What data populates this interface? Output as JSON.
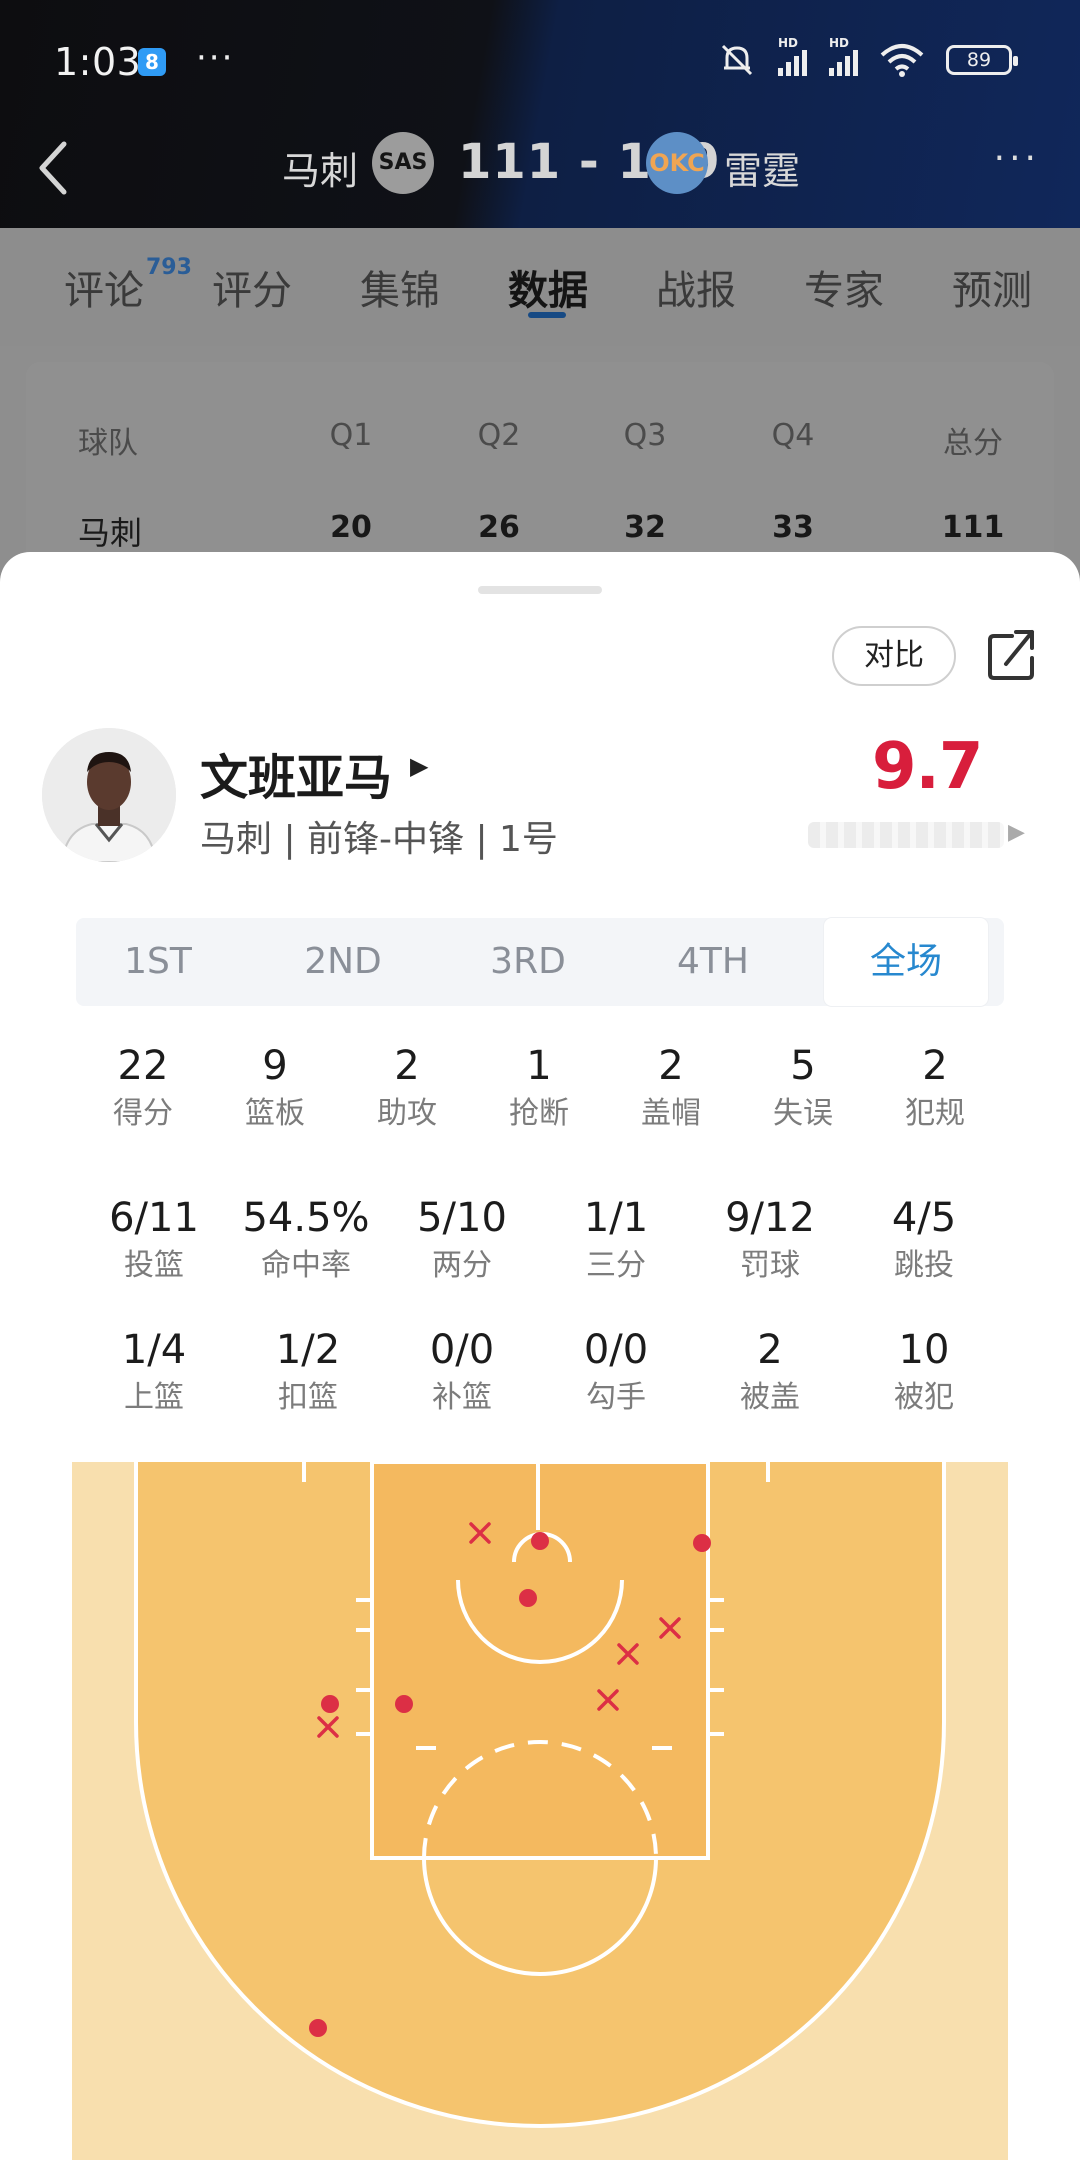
{
  "status_bar": {
    "time": "1:03",
    "app_badge": "8",
    "dots": "···",
    "hd": "HD",
    "battery": "89"
  },
  "scoreboard": {
    "home_team": "马刺",
    "home_abbr": "SAS",
    "score": "111 - 109",
    "away_abbr": "OKC",
    "away_team": "雷霆",
    "more": "···"
  },
  "tabs": [
    {
      "label": "评论",
      "badge": "793"
    },
    {
      "label": "评分"
    },
    {
      "label": "集锦"
    },
    {
      "label": "数据"
    },
    {
      "label": "战报"
    },
    {
      "label": "专家"
    },
    {
      "label": "预测"
    }
  ],
  "active_tab": "数据",
  "linescore": {
    "headers": [
      "球队",
      "Q1",
      "Q2",
      "Q3",
      "Q4",
      "总分"
    ],
    "row": [
      "马刺",
      "20",
      "26",
      "32",
      "33",
      "111"
    ]
  },
  "sheet": {
    "compare_label": "对比"
  },
  "player": {
    "name": "文班亚马",
    "meta": "马刺 | 前锋-中锋 | 1号",
    "rating": "9.7",
    "rating_color": "#d81e3c"
  },
  "periods": [
    "1ST",
    "2ND",
    "3RD",
    "4TH",
    "全场"
  ],
  "active_period": "全场",
  "basic_stats": [
    {
      "value": "22",
      "label": "得分"
    },
    {
      "value": "9",
      "label": "篮板"
    },
    {
      "value": "2",
      "label": "助攻"
    },
    {
      "value": "1",
      "label": "抢断"
    },
    {
      "value": "2",
      "label": "盖帽"
    },
    {
      "value": "5",
      "label": "失误"
    },
    {
      "value": "2",
      "label": "犯规"
    }
  ],
  "shooting_stats": [
    {
      "value": "6/11",
      "label": "投篮"
    },
    {
      "value": "54.5%",
      "label": "命中率"
    },
    {
      "value": "5/10",
      "label": "两分"
    },
    {
      "value": "1/1",
      "label": "三分"
    },
    {
      "value": "9/12",
      "label": "罚球"
    },
    {
      "value": "4/5",
      "label": "跳投"
    }
  ],
  "shot_type_stats": [
    {
      "value": "1/4",
      "label": "上篮"
    },
    {
      "value": "1/2",
      "label": "扣篮"
    },
    {
      "value": "0/0",
      "label": "补篮"
    },
    {
      "value": "0/0",
      "label": "勾手"
    },
    {
      "value": "2",
      "label": "被盖"
    },
    {
      "value": "10",
      "label": "被犯"
    }
  ],
  "shot_chart": {
    "made_color": "#dc2f45",
    "miss_color": "#dc2f45",
    "shots": [
      {
        "result": "miss",
        "zone": "paint-left-baseline"
      },
      {
        "result": "made",
        "zone": "under-basket"
      },
      {
        "result": "made",
        "zone": "paint-right-baseline"
      },
      {
        "result": "made",
        "zone": "restricted-area"
      },
      {
        "result": "miss",
        "zone": "mid-range-right"
      },
      {
        "result": "miss",
        "zone": "paint-right"
      },
      {
        "result": "miss",
        "zone": "free-throw-right"
      },
      {
        "result": "made",
        "zone": "mid-range-left"
      },
      {
        "result": "miss",
        "zone": "mid-range-left"
      },
      {
        "result": "made",
        "zone": "paint-left"
      },
      {
        "result": "made",
        "zone": "three-point-left"
      }
    ]
  }
}
